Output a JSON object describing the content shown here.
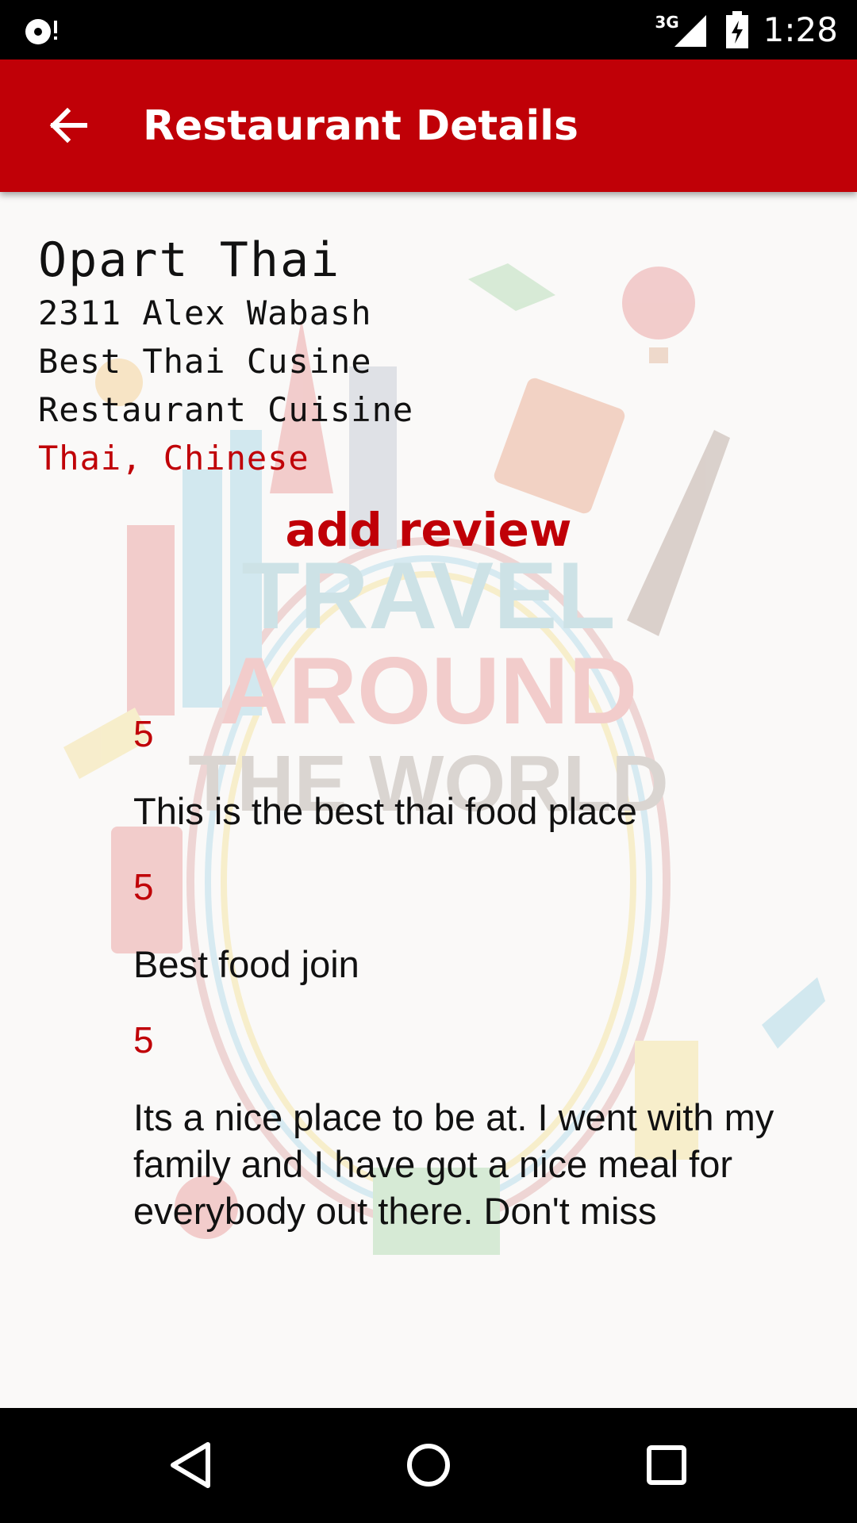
{
  "status_bar": {
    "network_type": "3G",
    "time": "1:28"
  },
  "app_bar": {
    "title": "Restaurant Details",
    "back_icon": "arrow-back-icon",
    "background_color": "#c00007"
  },
  "restaurant": {
    "name": "Opart Thai",
    "address": "2311 Alex Wabash",
    "tagline": "Best Thai Cusine",
    "cuisine_label": "Restaurant Cuisine",
    "cuisines": "Thai, Chinese"
  },
  "actions": {
    "add_review_label": "add review"
  },
  "background_art": {
    "line1": "TRAVEL",
    "line2": "AROUND",
    "line3": "THE WORLD"
  },
  "reviews": [
    {
      "rating": "5",
      "text": "This is the best thai food place"
    },
    {
      "rating": "5",
      "text": "Best food join"
    },
    {
      "rating": "5",
      "text": "Its a nice place to be at. I went with my family and I have got a nice meal for everybody out there. Don't miss"
    }
  ],
  "nav_bar": {
    "back_icon": "nav-back-icon",
    "home_icon": "nav-home-icon",
    "recents_icon": "nav-recents-icon"
  }
}
